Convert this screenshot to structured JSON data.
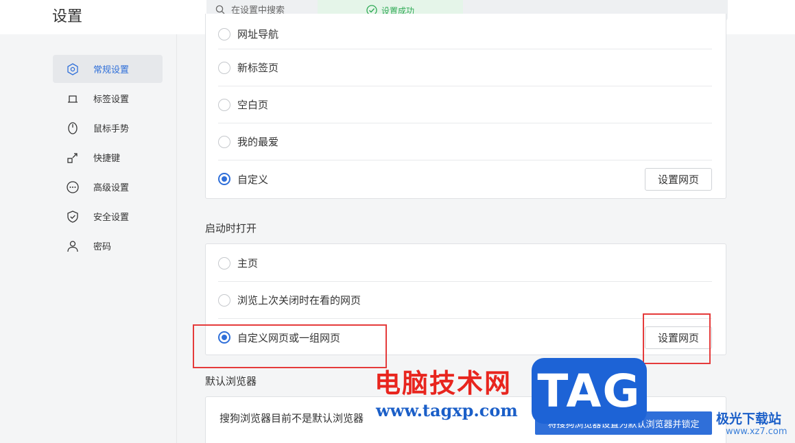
{
  "header": {
    "title": "设置",
    "search_placeholder": "在设置中搜索",
    "toast": "设置成功"
  },
  "sidebar": {
    "items": [
      {
        "label": "常规设置",
        "icon": "hexagon-settings-icon",
        "active": true
      },
      {
        "label": "标签设置",
        "icon": "tab-icon",
        "active": false
      },
      {
        "label": "鼠标手势",
        "icon": "mouse-icon",
        "active": false
      },
      {
        "label": "快捷键",
        "icon": "shortcut-arrow-icon",
        "active": false
      },
      {
        "label": "高级设置",
        "icon": "more-dots-icon",
        "active": false
      },
      {
        "label": "安全设置",
        "icon": "shield-check-icon",
        "active": false
      },
      {
        "label": "密码",
        "icon": "user-icon",
        "active": false
      }
    ]
  },
  "new_tab_card": {
    "partial_option": "网址导航",
    "options": [
      "新标签页",
      "空白页",
      "我的最爱",
      "自定义"
    ],
    "selected": "自定义",
    "set_button": "设置网页"
  },
  "startup": {
    "title": "启动时打开",
    "options": [
      "主页",
      "浏览上次关闭时在看的网页",
      "自定义网页或一组网页"
    ],
    "selected": "自定义网页或一组网页",
    "set_button": "设置网页"
  },
  "default_browser": {
    "title": "默认浏览器",
    "message": "搜狗浏览器目前不是默认浏览器",
    "button": "将搜狗浏览器设置为默认浏览器并锁定"
  },
  "watermark": {
    "site_cn": "电脑技术网",
    "site_url": "www.tagxp.com",
    "logo": "TAG",
    "brand2_cn": "极光下载站",
    "brand2_url": "www.xz7.com"
  },
  "colors": {
    "accent": "#2f6fd9",
    "highlight_red": "#e53a3a",
    "toast_green": "#2faa55"
  }
}
